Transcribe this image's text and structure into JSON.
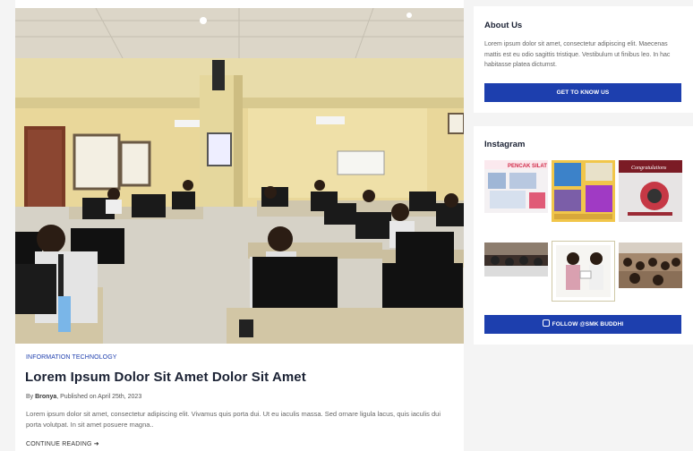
{
  "post": {
    "category": "INFORMATION TECHNOLOGY",
    "title": "Lorem Ipsum Dolor Sit Amet Dolor Sit Amet",
    "meta_by": "By",
    "author": "Bronya",
    "meta_published": ", Published on April 25th, 2023",
    "excerpt": "Lorem ipsum dolor sit amet, consectetur adipiscing elit. Vivamus quis porta dui. Ut eu iaculis massa. Sed ornare ligula lacus, quis iaculis dui porta volutpat. In sit amet posuere magna..",
    "read_more": "CONTINUE READING",
    "read_more_icon": "arrow-right-icon"
  },
  "about": {
    "title": "About Us",
    "text": "Lorem ipsum dolor sit amet, consectetur adipiscing elit. Maecenas mattis est eu odio sagittis tristique. Vestibulum ut finibus leo. In hac habitasse platea dictumst.",
    "button": "GET TO KNOW US"
  },
  "instagram": {
    "title": "Instagram",
    "button": "FOLLOW @SMK BUDDHI",
    "button_icon": "instagram-icon",
    "thumb_text": {
      "pencak": "PENCAK SILAT",
      "congrat": "Congratulations"
    }
  },
  "colors": {
    "accent": "#1d3fae",
    "title": "#1b2234",
    "body_text": "#666666"
  }
}
